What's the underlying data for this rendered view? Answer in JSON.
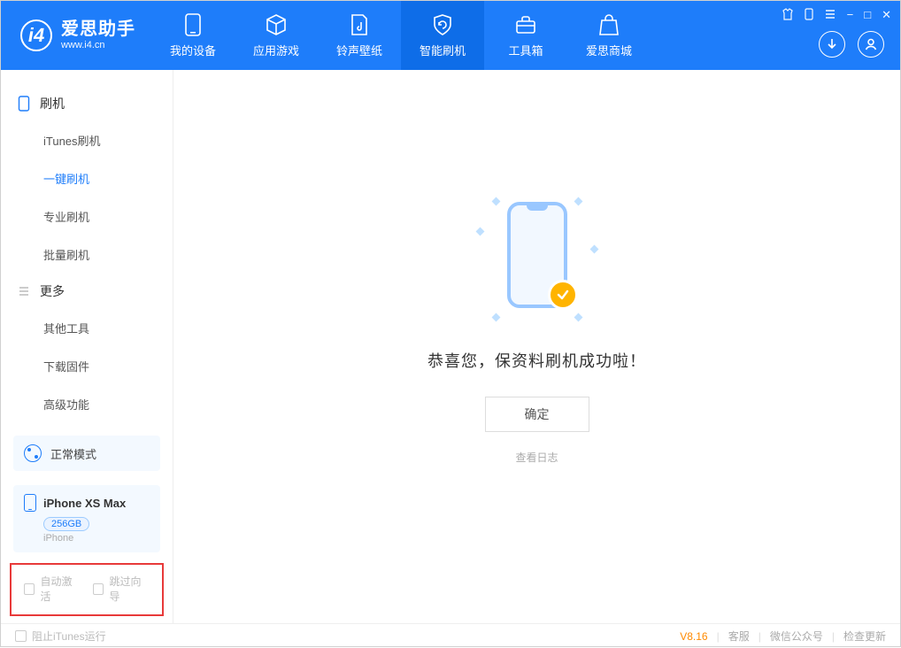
{
  "colors": {
    "accent": "#1E7DFA",
    "highlight_border": "#E83A3A",
    "warn": "#FF8A00"
  },
  "header": {
    "app_name_cn": "爱思助手",
    "app_url": "www.i4.cn",
    "tabs": [
      {
        "id": "device",
        "label": "我的设备",
        "icon": "phone-icon"
      },
      {
        "id": "apps",
        "label": "应用游戏",
        "icon": "cube-icon"
      },
      {
        "id": "ringtones",
        "label": "铃声壁纸",
        "icon": "music-file-icon"
      },
      {
        "id": "flash",
        "label": "智能刷机",
        "icon": "refresh-shield-icon",
        "active": true
      },
      {
        "id": "tools",
        "label": "工具箱",
        "icon": "toolbox-icon"
      },
      {
        "id": "store",
        "label": "爱思商城",
        "icon": "bag-icon"
      }
    ],
    "window_controls": {
      "shirt": "shirt-icon",
      "phone": "phone-small-icon",
      "menu": "menu-icon",
      "min": "−",
      "max": "□",
      "close": "✕"
    },
    "right_circles": {
      "download": "download-icon",
      "user": "user-icon"
    }
  },
  "sidebar": {
    "section_flash": "刷机",
    "section_more": "更多",
    "items_flash": [
      {
        "id": "itunes",
        "label": "iTunes刷机"
      },
      {
        "id": "onekey",
        "label": "一键刷机",
        "active": true
      },
      {
        "id": "pro",
        "label": "专业刷机"
      },
      {
        "id": "batch",
        "label": "批量刷机"
      }
    ],
    "items_more": [
      {
        "id": "other",
        "label": "其他工具"
      },
      {
        "id": "firmware",
        "label": "下载固件"
      },
      {
        "id": "advanced",
        "label": "高级功能"
      }
    ],
    "mode": {
      "label": "正常模式"
    },
    "device": {
      "name": "iPhone XS Max",
      "storage": "256GB",
      "type": "iPhone"
    },
    "checkboxes": {
      "auto_activate": "自动激活",
      "skip_guide": "跳过向导"
    }
  },
  "main": {
    "success_text": "恭喜您，保资料刷机成功啦！",
    "ok_button": "确定",
    "log_link": "查看日志"
  },
  "footer": {
    "block_itunes": "阻止iTunes运行",
    "version": "V8.16",
    "links": {
      "support": "客服",
      "wechat": "微信公众号",
      "update": "检查更新"
    }
  }
}
